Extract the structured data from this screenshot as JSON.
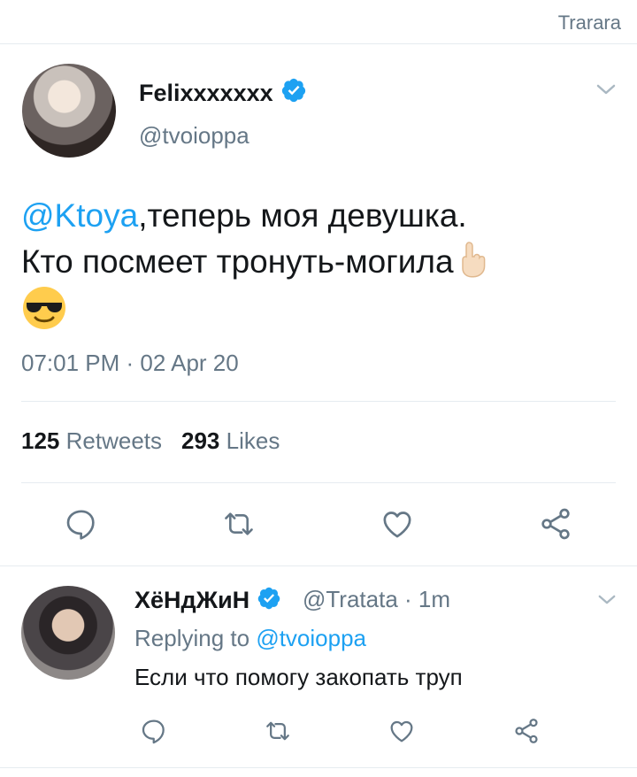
{
  "topbar": {
    "label": "Trarara"
  },
  "tweet": {
    "author_name": "Felixxxxxxx",
    "author_handle": "@tvoioppa",
    "mention": "@Ktoya",
    "text_line1": ",теперь моя девушка.",
    "text_line2": "Кто посмеет тронуть-могила",
    "emoji_point": "pointing-up-emoji",
    "emoji_cool": "sunglasses-emoji",
    "timestamp": "07:01 PM · 02 Apr 20",
    "retweets_count": "125",
    "retweets_label": "Retweets",
    "likes_count": "293",
    "likes_label": "Likes"
  },
  "reply": {
    "author_name": "ХёНдЖиН",
    "author_handle": "@Tratata · 1m",
    "replying_prefix": "Replying to ",
    "replying_handle": "@tvoioppa",
    "text": "Если что помогу закопать труп"
  },
  "icons": [
    "verified-badge-icon",
    "chevron-down-icon",
    "reply-icon",
    "retweet-icon",
    "like-icon",
    "share-icon"
  ],
  "colors": {
    "accent": "#1da1f2",
    "secondary_text": "#657786",
    "divider": "#e6ecf0",
    "primary_text": "#14171a"
  }
}
